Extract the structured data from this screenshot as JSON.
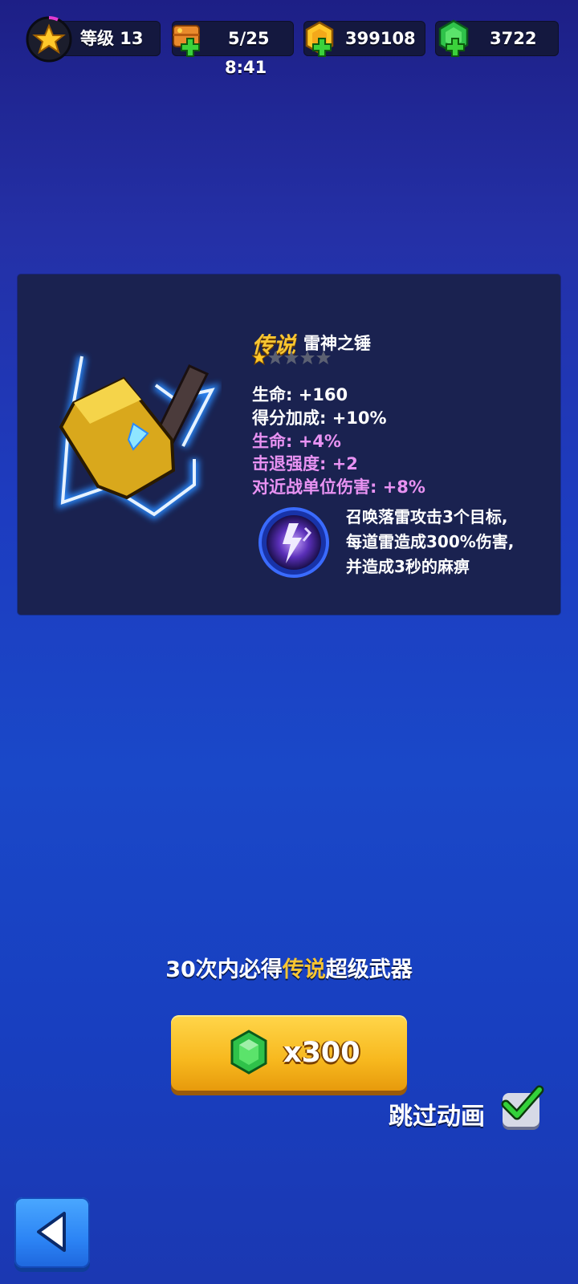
{
  "topbar": {
    "level_label": "等级 13",
    "energy": "5/25",
    "energy_timer": "8:41",
    "coins": "399108",
    "gems": "3722"
  },
  "weapon": {
    "rarity": "传说",
    "name": "雷神之锤",
    "stars_filled": 1,
    "stars_total": 5,
    "stats": [
      {
        "text": "生命: +160",
        "color": "white"
      },
      {
        "text": "得分加成: +10%",
        "color": "white"
      },
      {
        "text": "生命: +4%",
        "color": "pink"
      },
      {
        "text": "击退强度: +2",
        "color": "pink"
      },
      {
        "text": "对近战单位伤害: +8%",
        "color": "pink"
      }
    ],
    "skill_lines": [
      "召唤落雷攻击3个目标,",
      "每道雷造成300%伤害,",
      "并造成3秒的麻痹"
    ]
  },
  "guarantee": {
    "prefix": "30次内必得",
    "highlight": "传说",
    "suffix": "超级武器"
  },
  "buy_button": {
    "cost": "x300"
  },
  "skip_animation": {
    "label": "跳过动画",
    "checked": true
  },
  "colors": {
    "gold": "#f7c531",
    "pink_stat": "#e892f2",
    "gem_green": "#2fc24a",
    "panel": "#1a2250"
  },
  "icons": [
    "star-icon",
    "treasure-chest-icon",
    "coin-icon",
    "gem-icon",
    "plus-icon",
    "thor-hammer-icon",
    "lightning-skill-icon",
    "checkmark-icon",
    "back-arrow-icon"
  ]
}
